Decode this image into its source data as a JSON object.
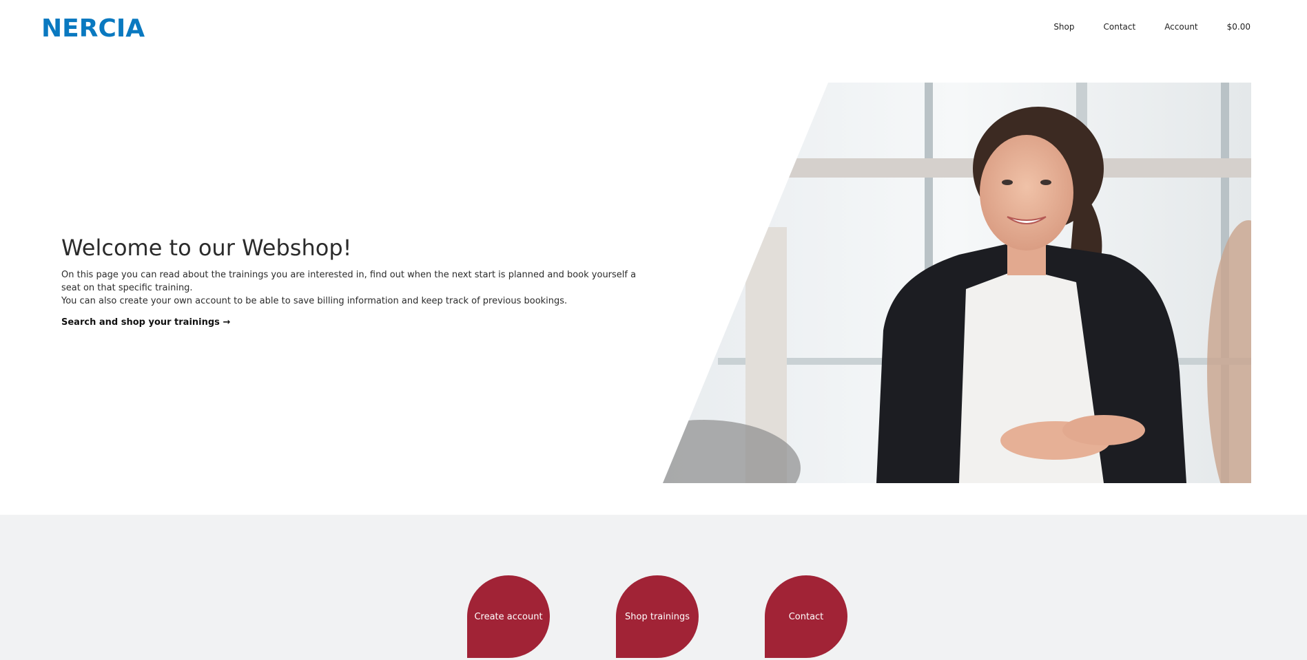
{
  "header": {
    "logo": "NERCIA",
    "nav": {
      "shop": "Shop",
      "contact": "Contact",
      "account": "Account",
      "cart": "$0.00"
    }
  },
  "hero": {
    "title": "Welcome to our Webshop!",
    "paragraph1": "On this page you can read about the trainings you are interested in, find out when the next start is planned and book yourself a seat on that specific training.",
    "paragraph2": "You can also create your own account to be able to save billing information and keep track of previous bookings.",
    "cta": "Search and shop your trainings →"
  },
  "features": {
    "create_account": "Create account",
    "shop_trainings": "Shop trainings",
    "contact": "Contact"
  },
  "colors": {
    "brand_blue": "#0a79c0",
    "accent_red": "#a12336",
    "section_gray": "#f1f2f3"
  }
}
